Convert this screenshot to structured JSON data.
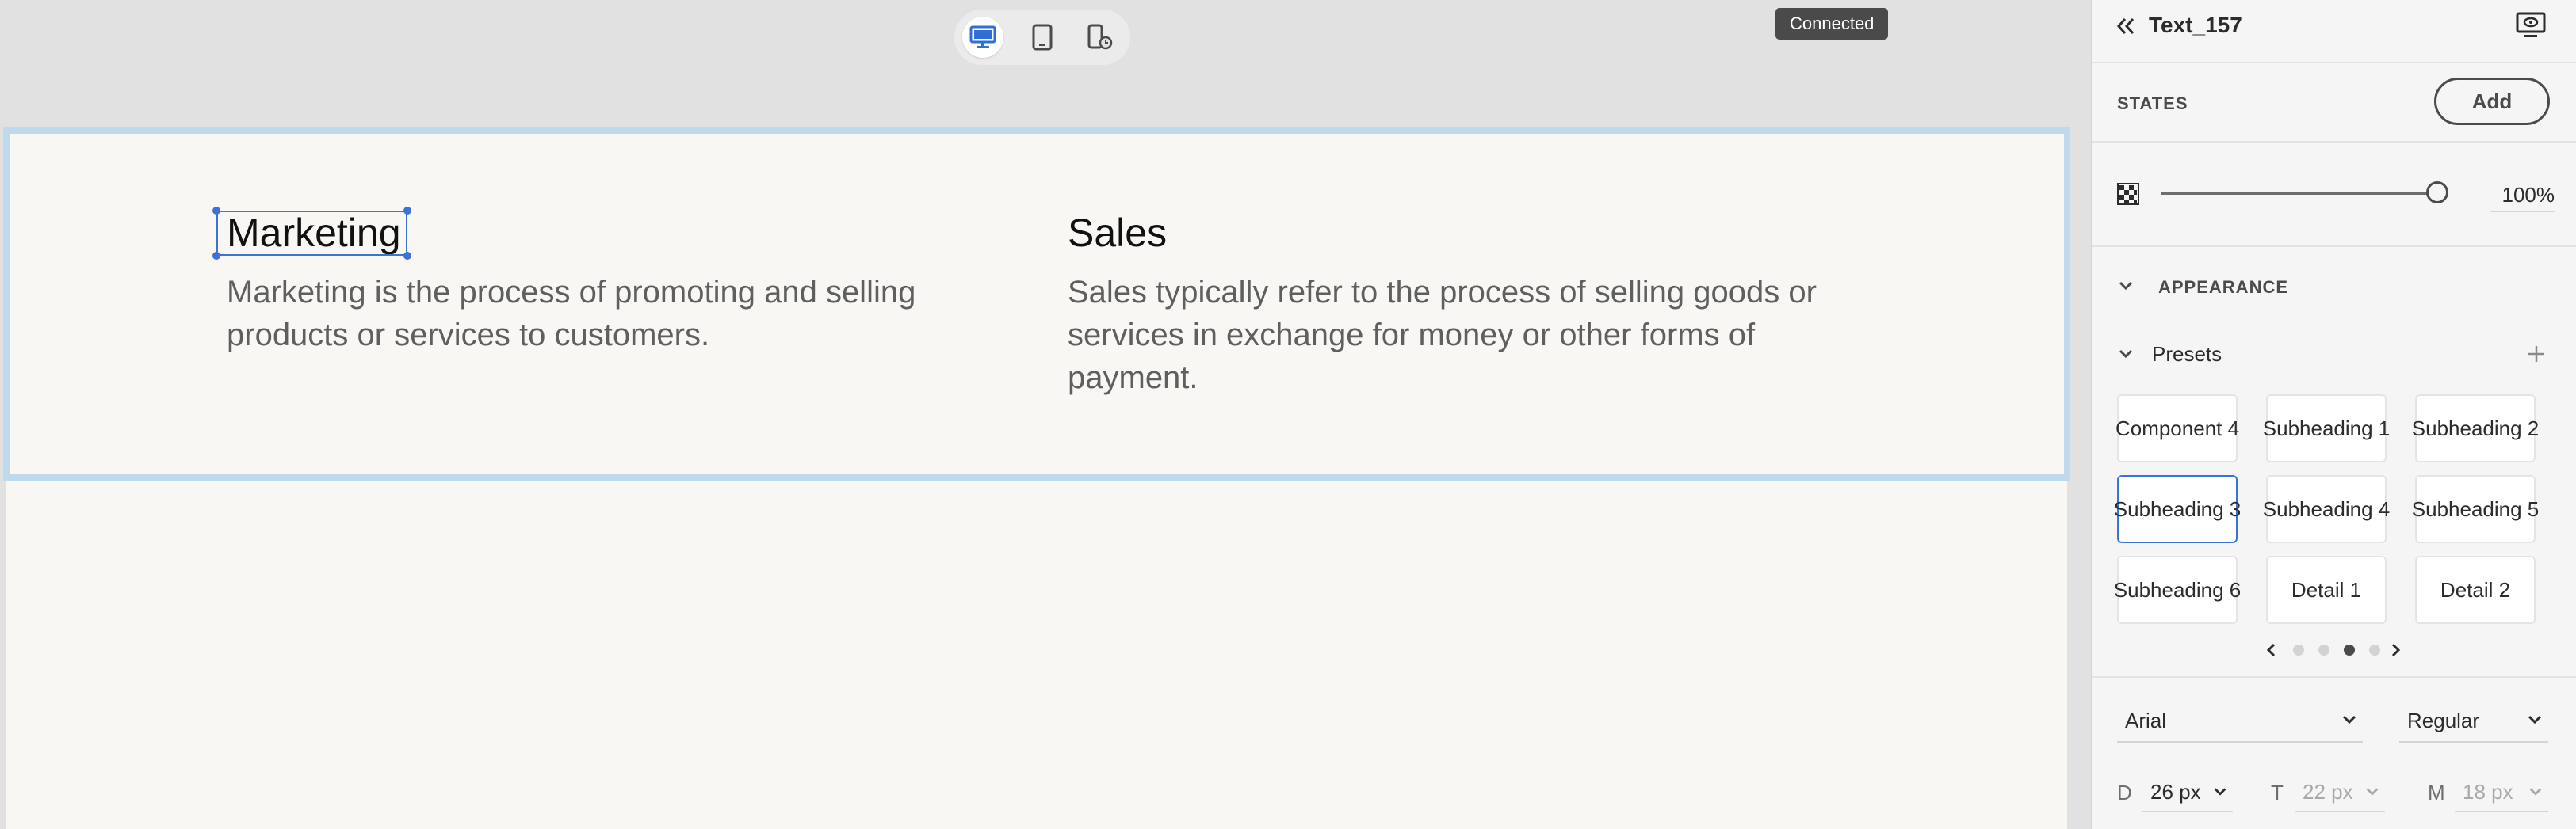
{
  "toolbar": {
    "devices": [
      "desktop-icon",
      "tablet-icon",
      "phone-rotate-icon"
    ],
    "active_device": "desktop",
    "connection_status": "Connected"
  },
  "canvas": {
    "columns": [
      {
        "title": "Marketing",
        "body": "Marketing is the process of promoting and selling products or services to customers."
      },
      {
        "title": "Sales",
        "body": "Sales typically refer to the process of selling goods or services in exchange for money or other forms of payment."
      }
    ]
  },
  "panel": {
    "element_name": "Text_157",
    "states": {
      "label": "STATES",
      "add_button": "Add"
    },
    "opacity": {
      "value": "100%",
      "fraction": 1.0
    },
    "appearance": {
      "label": "APPEARANCE"
    },
    "presets": {
      "label": "Presets",
      "items": [
        "Component 4",
        "Subheading 1",
        "Subheading 2",
        "Subheading 3",
        "Subheading 4",
        "Subheading 5",
        "Subheading 6",
        "Detail 1",
        "Detail 2"
      ],
      "selected_index": 3,
      "page_count": 4,
      "current_page_index": 2
    },
    "font": {
      "family": "Arial",
      "weight": "Regular"
    },
    "sizes": [
      {
        "label": "D",
        "value": "26 px"
      },
      {
        "label": "T",
        "value": "22 px"
      },
      {
        "label": "M",
        "value": "18 px"
      }
    ]
  },
  "colors": {
    "accent": "#3b74d6",
    "canvas_background": "#f8f7f4",
    "section_highlight": "#c0d9ec"
  }
}
